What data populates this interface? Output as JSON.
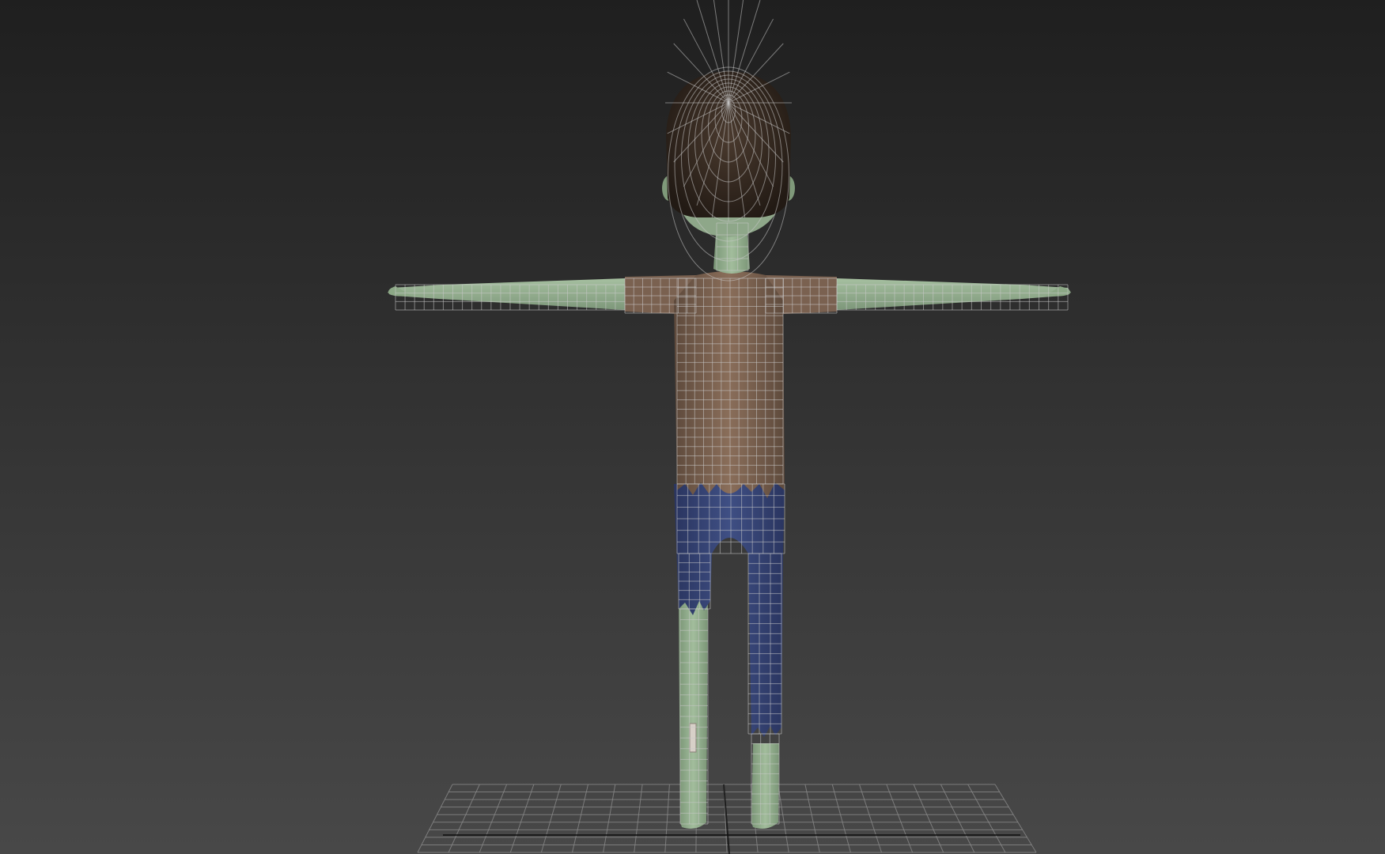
{
  "viewport": {
    "shading": "smooth-shaded-with-wireframe",
    "background_top": "#1f1f1f",
    "background_bottom": "#484848"
  },
  "model": {
    "pose": "T-pose",
    "view": "front",
    "colors": {
      "hair": "#3a2c22",
      "skin": "#92ad8d",
      "shirt": "#7e6452",
      "pants": "#3a4878",
      "wire": "#c8c8c8"
    }
  },
  "ground_grid": {
    "visible": true,
    "color": "#8a8a8a"
  }
}
